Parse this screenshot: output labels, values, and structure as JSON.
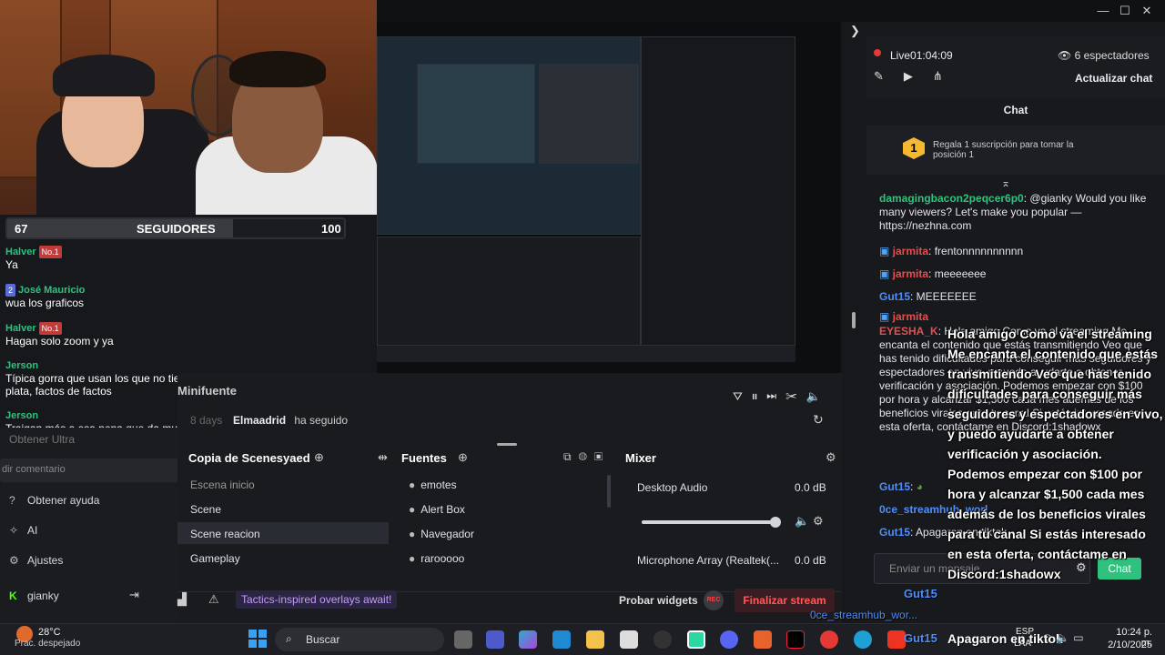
{
  "stream": {
    "live_time": "Live01:04:09",
    "viewers": "6 espectadores",
    "refresh_chat": "Actualizar chat",
    "chat_tab": "Chat",
    "reward": "Regala 1 suscripción para tomar la posición 1",
    "reward_count": "1"
  },
  "overlay": {
    "follow_count": "67",
    "follow_label": "SEGUIDORES",
    "follow_goal": "100",
    "follow_progress": 0.67,
    "messages": [
      {
        "user": "Halver",
        "badge": "No.1",
        "text": "Ya"
      },
      {
        "user": "José Mauricio",
        "badge": "2",
        "text": "wua los graficos"
      },
      {
        "user": "Halver",
        "badge": "No.1",
        "text": "Hagan solo zoom y ya"
      },
      {
        "user": "Jerson",
        "badge": "",
        "text": "Típica gorra que usan los que no tienen plata, factos de factos"
      },
      {
        "user": "Jerson",
        "badge": "",
        "text": "Traigan más a esa nena que da mucha risa"
      }
    ]
  },
  "sidebar": {
    "minifuente": "Minifuente",
    "days": "8 days",
    "obtener_ultra": "Obtener Ultra",
    "comment_placeholder": "dir comentario",
    "obtener_ayuda": "Obtener ayuda",
    "ai": "AI",
    "ajustes": "Ajustes",
    "user": "gianky"
  },
  "activity": {
    "follower": "Elmaadrid",
    "action": "ha seguido"
  },
  "scenes": {
    "header": "Copia de Scenesyaed",
    "items": [
      "Escena inicio",
      "Scene",
      "Scene reacion",
      "Gameplay"
    ]
  },
  "sources": {
    "header": "Fuentes",
    "items": [
      "emotes",
      "Alert Box",
      "Navegador",
      "rarooooo"
    ]
  },
  "mixer": {
    "header": "Mixer",
    "desktop_label": "Desktop Audio",
    "desktop_db": "0.0 dB",
    "desktop_level": 0.98,
    "mic_label": "Microphone Array (Realtek(...",
    "mic_db": "0.0 dB"
  },
  "bottombar": {
    "promo": "Tactics-inspired overlays await!",
    "test_widgets": "Probar widgets",
    "rec": "REC",
    "end_stream": "Finalizar stream"
  },
  "chat": {
    "messages": [
      {
        "user": "damagingbacon2peqcer6p0",
        "text": ": @gianky Would you like many viewers? Let's make you popular — https://nezhna.com"
      },
      {
        "user": "jarmita",
        "text": ": frentonnnnnnnnnn"
      },
      {
        "user": "jarmita",
        "text": ": meeeeeee"
      },
      {
        "user": "Gut15",
        "text": ": MEEEEEEE"
      },
      {
        "user": "jarmita",
        "text": ""
      },
      {
        "user": "EYESHA_K",
        "text": ": Hola amigo Como va el streaming Me encanta el contenido que estás transmitiendo Veo que has tenido dificultades para conseguir más seguidores y espectadores en vivo, y puedo ayudarte a obtener verificación y asociación. Podemos empezar con $100 por hora y alcanzar $1,500 cada mes además de los beneficios virales para tu canal Si estás interesado en esta oferta, contáctame en Discord:1shadowx"
      },
      {
        "user": "Gut15",
        "text": ":"
      },
      {
        "user": "0ce_streamhub_worl",
        "text": ""
      },
      {
        "user": "Gut15",
        "text": ": Apagaron en tiktok"
      }
    ],
    "input_placeholder": "Enviar un mensaje",
    "send_label": "Chat"
  },
  "big_overlay": {
    "lines1": [
      "Hola amigo Como va el streaming",
      "Me encanta el contenido que estás",
      "transmitiendo Veo que has tenido",
      "dificultades para conseguir más",
      "seguidores y espectadores en vivo,",
      "y puedo ayudarte a obtener",
      "verificación y asociación."
    ],
    "lines2": [
      "Podemos empezar con $100 por",
      "hora y alcanzar $1,500 cada mes",
      "además de los beneficios virales",
      "para tu canal Si estás interesado",
      "en esta oferta, contáctame en",
      "Discord:1shadowx"
    ],
    "gut_label": "Gut15",
    "stream_label": "0ce_streamhub_wor...",
    "gut_label2": "Gut15",
    "tiktok": "Apagaron en tiktok"
  },
  "taskbar": {
    "weather_temp": "28°C",
    "weather_desc": "Prac. despejado",
    "search": "Buscar",
    "lang": "ESP",
    "lang2": "LAA",
    "time": "10:24 p. m.",
    "date": "2/10/2025"
  }
}
